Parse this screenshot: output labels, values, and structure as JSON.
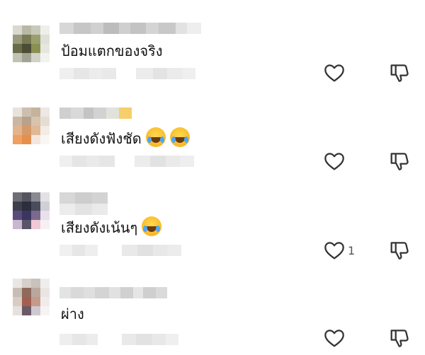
{
  "comments": [
    {
      "text": "ป้อมแตกของจริง",
      "emoji_count": 0,
      "like_count": ""
    },
    {
      "text": "เสียงดังฟังชัด",
      "emoji_count": 2,
      "like_count": ""
    },
    {
      "text": "เสียงดังเน้นๆ",
      "emoji_count": 1,
      "like_count": "1"
    },
    {
      "text": "ผ่าง",
      "emoji_count": 0,
      "like_count": ""
    }
  ],
  "icons": {
    "like": "heart-outline-icon",
    "dislike": "thumbs-down-outline-icon",
    "emoji": "face-with-tears-of-joy"
  },
  "colors": {
    "icon": "#333333",
    "text": "#111111",
    "blur": "#e6e6e6"
  }
}
